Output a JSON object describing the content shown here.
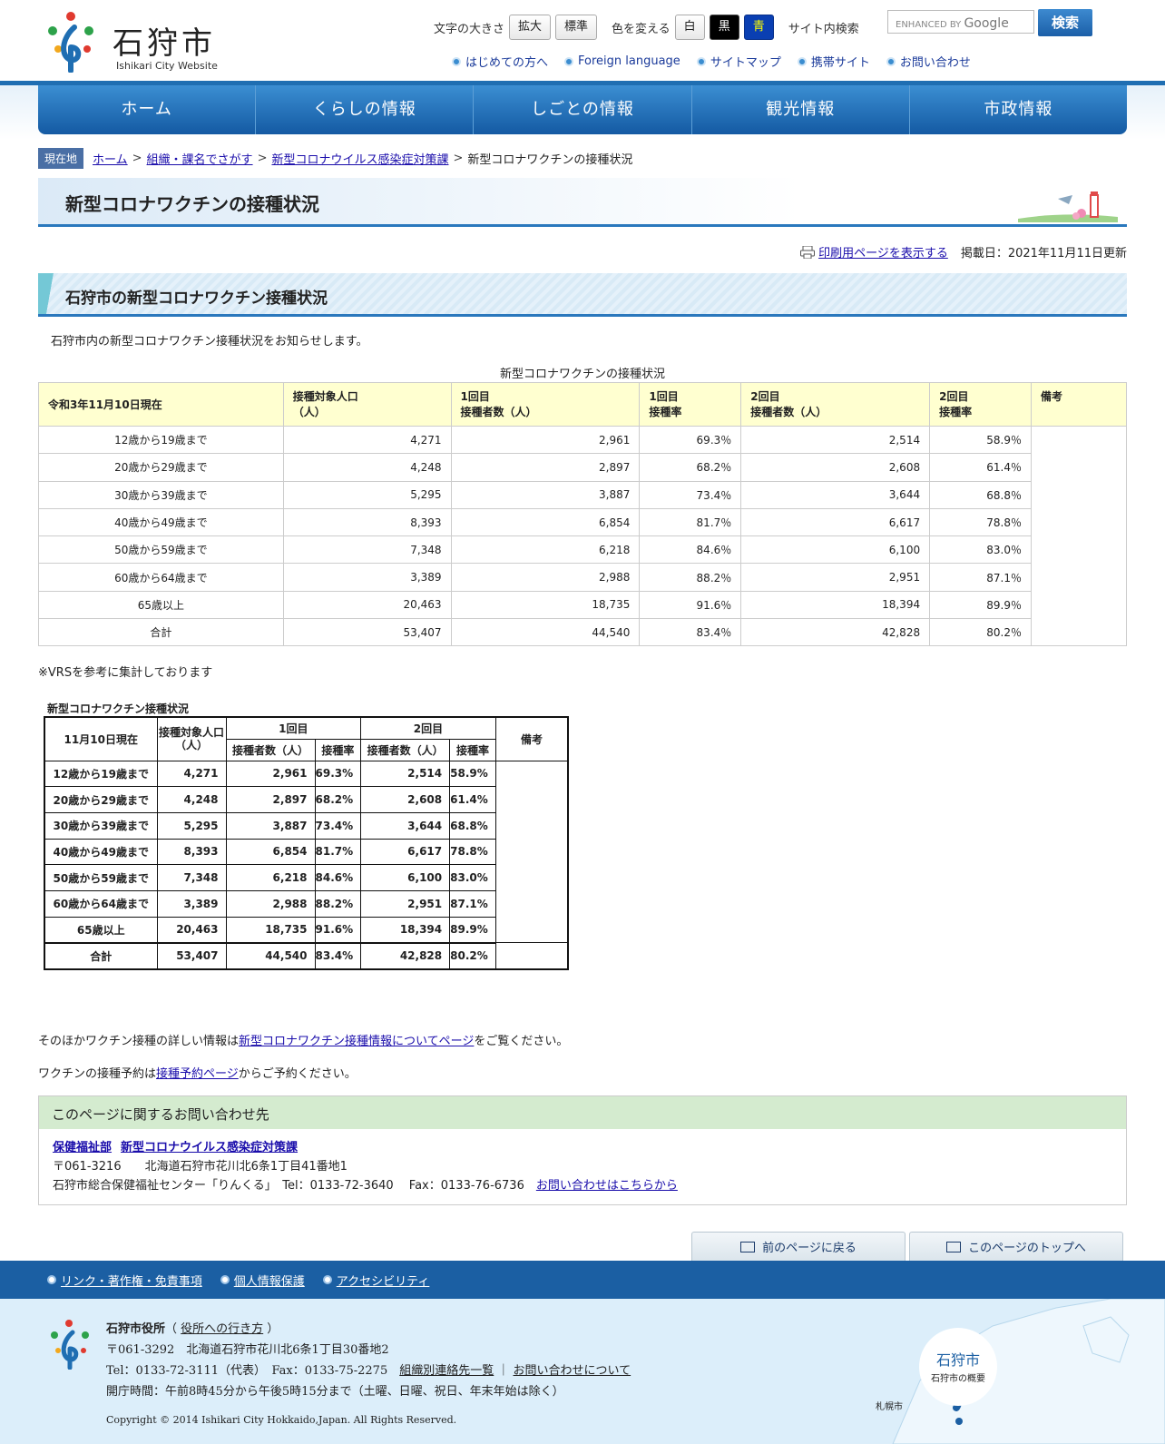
{
  "header": {
    "logo_text": "石狩市",
    "logo_sub": "Ishikari City Website",
    "font_size_label": "文字の大きさ",
    "font_large": "拡大",
    "font_normal": "標準",
    "color_label": "色を変える",
    "color_white": "白",
    "color_black": "黒",
    "color_blue": "青",
    "site_search_label": "サイト内検索",
    "search_placeholder_small": "ENHANCED BY",
    "search_placeholder_brand": "Google",
    "search_button": "検索",
    "sublinks": [
      "はじめての方へ",
      "Foreign language",
      "サイトマップ",
      "携帯サイト",
      "お問い合わせ"
    ]
  },
  "nav": [
    "ホーム",
    "くらしの情報",
    "しごとの情報",
    "観光情報",
    "市政情報"
  ],
  "breadcrumb": {
    "tag": "現在地",
    "items": [
      "ホーム",
      "組織・課名でさがす",
      "新型コロナウイルス感染症対策課"
    ],
    "current": "新型コロナワクチンの接種状況"
  },
  "page": {
    "title": "新型コロナワクチンの接種状況",
    "print_link": "印刷用ページを表示する",
    "posted": "掲載日：2021年11月11日更新",
    "section_title": "石狩市の新型コロナワクチン接種状況",
    "intro": "石狩市内の新型コロナワクチン接種状況をお知らせします。",
    "table_caption": "新型コロナワクチンの接種状況",
    "vrs_note": "※VRSを参考に集計しております",
    "more_pre": "そのほかワクチン接種の詳しい情報は",
    "more_link": "新型コロナワクチン接種情報についてページ",
    "more_post": "をご覧ください。",
    "reserve_pre": "ワクチンの接種予約は",
    "reserve_link": "接種予約ページ",
    "reserve_post": "からご予約ください。"
  },
  "table": {
    "headers": [
      "令和3年11月10日現在",
      "接種対象人口\n（人）",
      "1回目\n接種者数（人）",
      "1回目\n接種率",
      "2回目\n接種者数（人）",
      "2回目\n接種率",
      "備考"
    ],
    "rows": [
      [
        "12歳から19歳まで",
        "4,271",
        "2,961",
        "69.3％",
        "2,514",
        "58.9％"
      ],
      [
        "20歳から29歳まで",
        "4,248",
        "2,897",
        "68.2％",
        "2,608",
        "61.4％"
      ],
      [
        "30歳から39歳まで",
        "5,295",
        "3,887",
        "73.4％",
        "3,644",
        "68.8％"
      ],
      [
        "40歳から49歳まで",
        "8,393",
        "6,854",
        "81.7％",
        "6,617",
        "78.8％"
      ],
      [
        "50歳から59歳まで",
        "7,348",
        "6,218",
        "84.6％",
        "6,100",
        "83.0％"
      ],
      [
        "60歳から64歳まで",
        "3,389",
        "2,988",
        "88.2％",
        "2,951",
        "87.1％"
      ],
      [
        "65歳以上",
        "20,463",
        "18,735",
        "91.6％",
        "18,394",
        "89.9％"
      ],
      [
        "合計",
        "53,407",
        "44,540",
        "83.4％",
        "42,828",
        "80.2％"
      ]
    ]
  },
  "image_table": {
    "caption": "新型コロナワクチン接種状況",
    "h_date": "11月10日現在",
    "h_pop": "接種対象人口（人）",
    "h_first": "1回目",
    "h_second": "2回目",
    "h_note": "備考",
    "h_count": "接種者数（人）",
    "h_rate": "接種率",
    "rows": [
      [
        "12歳から19歳まで",
        "4,271",
        "2,961",
        "69.3%",
        "2,514",
        "58.9%"
      ],
      [
        "20歳から29歳まで",
        "4,248",
        "2,897",
        "68.2%",
        "2,608",
        "61.4%"
      ],
      [
        "30歳から39歳まで",
        "5,295",
        "3,887",
        "73.4%",
        "3,644",
        "68.8%"
      ],
      [
        "40歳から49歳まで",
        "8,393",
        "6,854",
        "81.7%",
        "6,617",
        "78.8%"
      ],
      [
        "50歳から59歳まで",
        "7,348",
        "6,218",
        "84.6%",
        "6,100",
        "83.0%"
      ],
      [
        "60歳から64歳まで",
        "3,389",
        "2,988",
        "88.2%",
        "2,951",
        "87.1%"
      ],
      [
        "65歳以上",
        "20,463",
        "18,735",
        "91.6%",
        "18,394",
        "89.9%"
      ],
      [
        "合計",
        "53,407",
        "44,540",
        "83.4%",
        "42,828",
        "80.2%"
      ]
    ]
  },
  "contact": {
    "heading": "このページに関するお問い合わせ先",
    "dept": "保健福祉部",
    "section": "新型コロナウイルス感染症対策課",
    "address": "〒061-3216　　北海道石狩市花川北6条1丁目41番地1",
    "office": "石狩市総合保健福祉センター「りんくる」　Tel：0133-72-3640　 Fax：0133-76-6736",
    "inquiry_link": "お問い合わせはこちらから"
  },
  "tabs": {
    "back": "前のページに戻る",
    "top": "このページのトップへ"
  },
  "footer": {
    "links": [
      "リンク・著作権・免責事項",
      "個人情報保護",
      "アクセシビリティ"
    ],
    "office_name": "石狩市役所",
    "directions": "役所への行き方",
    "address": "〒061-3292　北海道石狩市花川北6条1丁目30番地2",
    "tel": "Tel：0133-72-3111（代表）　Fax：0133-75-2275",
    "org_contacts": "組織別連絡先一覧",
    "about_inquiry": "お問い合わせについて",
    "hours": "開庁時間：午前8時45分から午後5時15分まで（土曜、日曜、祝日、年末年始は除く）",
    "copyright": "Copyright © 2014 Ishikari City Hokkaido,Japan. All Rights Reserved.",
    "badge_title": "石狩市",
    "badge_sub": "石狩市の概要",
    "map_city": "札幌市"
  },
  "colors": {
    "accent": "#1b5fa3",
    "table_header": "#ffffd0",
    "contact_header": "#d4ebcf"
  }
}
